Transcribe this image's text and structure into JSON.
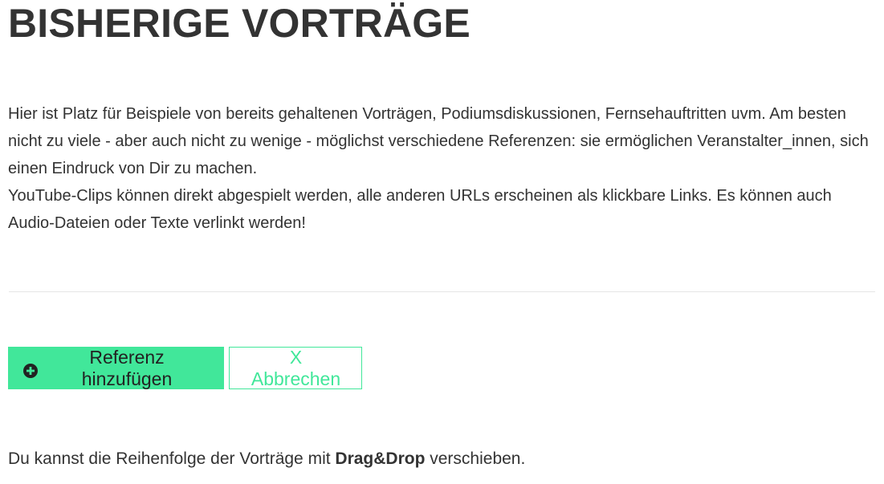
{
  "page": {
    "title": "BISHERIGE VORTRÄGE"
  },
  "intro": {
    "paragraph1": "Hier ist Platz für Beispiele von bereits gehaltenen Vorträgen, Podiumsdiskussionen, Fernsehauftritten uvm. Am besten nicht zu viele - aber auch nicht zu wenige - möglichst verschiedene Referenzen: sie ermöglichen Veranstalter_innen, sich einen Eindruck von Dir zu machen.",
    "paragraph2": "YouTube-Clips können direkt abgespielt werden, alle anderen URLs erscheinen als klickbare Links. Es können auch Audio-Dateien oder Texte verlinkt werden!"
  },
  "actions": {
    "add_label": "Referenz hinzufügen",
    "add_icon": "plus-circle-icon",
    "cancel_label": "X Abbrechen"
  },
  "hint": {
    "before": "Du kannst die Reihenfolge der Vorträge mit ",
    "bold": "Drag&Drop",
    "after": " verschieben."
  },
  "colors": {
    "accent": "#41e79a",
    "text": "#333333",
    "divider": "#e6e6e6"
  }
}
